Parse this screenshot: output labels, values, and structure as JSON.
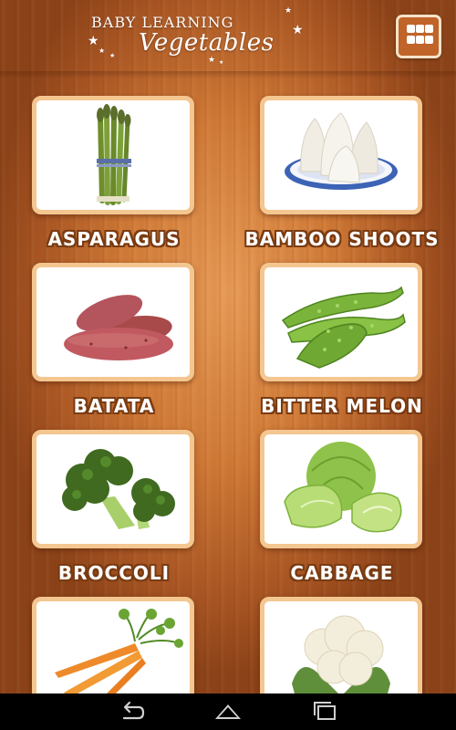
{
  "header": {
    "title_top": "BABY  LEARNING",
    "title_main": "Vegetables",
    "menu_icon": "grid-icon"
  },
  "vegetables": [
    {
      "name": "ASPARAGUS",
      "icon": "asparagus-image"
    },
    {
      "name": "BAMBOO SHOOTS",
      "icon": "bamboo-shoots-image"
    },
    {
      "name": "BATATA",
      "icon": "batata-image"
    },
    {
      "name": "BITTER MELON",
      "icon": "bitter-melon-image"
    },
    {
      "name": "BROCCOLI",
      "icon": "broccoli-image"
    },
    {
      "name": "CABBAGE",
      "icon": "cabbage-image"
    },
    {
      "name": "",
      "icon": "carrot-image"
    },
    {
      "name": "",
      "icon": "cauliflower-image"
    }
  ],
  "navbar": {
    "back_icon": "back-icon",
    "home_icon": "home-icon",
    "recents_icon": "recents-icon"
  },
  "colors": {
    "wood": "#d07a37",
    "card_border": "#f4c690",
    "label_outline": "#7a3b12",
    "menu_bg": "#c0642a"
  }
}
